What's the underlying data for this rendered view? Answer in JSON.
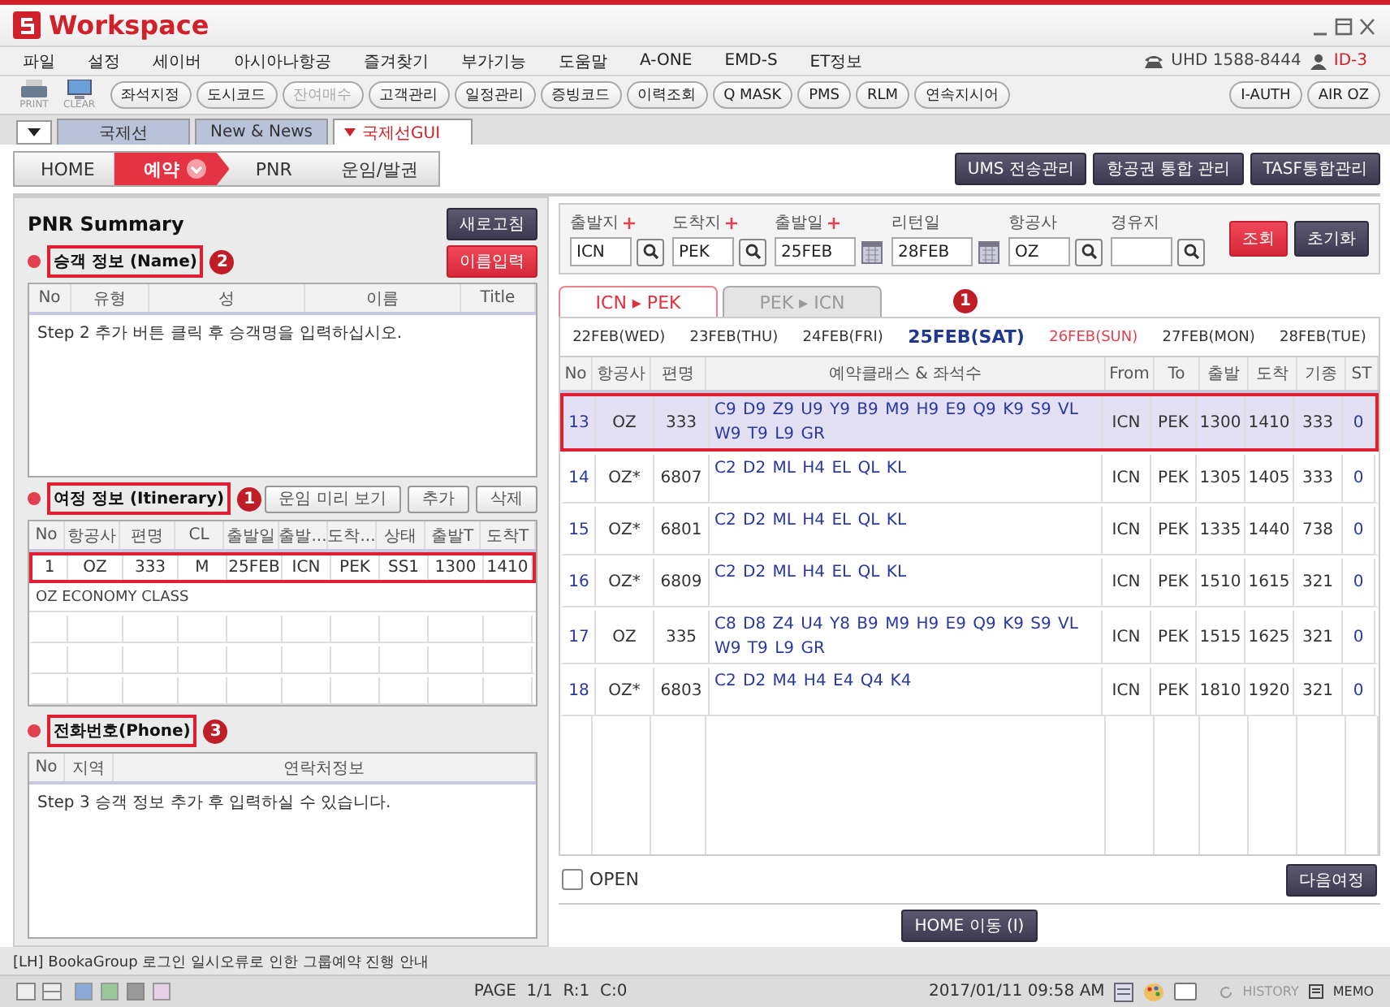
{
  "window": {
    "title": "Workspace"
  },
  "menu": [
    "파일",
    "설정",
    "세이버",
    "아시아나항공",
    "즐겨찾기",
    "부가기능",
    "도움말",
    "A-ONE",
    "EMD-S",
    "ET정보"
  ],
  "support": {
    "phone": "UHD 1588-8444",
    "user": "ID-3"
  },
  "toolbar": {
    "icon_buttons": [
      {
        "label": "PRINT",
        "kind": "printer"
      },
      {
        "label": "CLEAR",
        "kind": "monitor"
      }
    ],
    "buttons": [
      {
        "label": "좌석지정",
        "disabled": false
      },
      {
        "label": "도시코드",
        "disabled": false
      },
      {
        "label": "잔여매수",
        "disabled": true
      },
      {
        "label": "고객관리",
        "disabled": false
      },
      {
        "label": "일정관리",
        "disabled": false
      },
      {
        "label": "증빙코드",
        "disabled": false
      },
      {
        "label": "이력조회",
        "disabled": false
      },
      {
        "label": "Q MASK",
        "disabled": false
      },
      {
        "label": "PMS",
        "disabled": false
      },
      {
        "label": "RLM",
        "disabled": false
      },
      {
        "label": "연속지시어",
        "disabled": false
      }
    ],
    "right_buttons": [
      {
        "label": "I-AUTH",
        "disabled": false
      },
      {
        "label": "AIR OZ",
        "disabled": false
      }
    ]
  },
  "tabs": [
    {
      "label": "국제선",
      "selected": false
    },
    {
      "label": "New & News",
      "selected": false
    },
    {
      "label": "국제선GUI",
      "selected": true
    }
  ],
  "breadcrumb": [
    {
      "label": "HOME",
      "selected": false
    },
    {
      "label": "예약",
      "selected": true
    },
    {
      "label": "PNR",
      "selected": false
    },
    {
      "label": "운임/발권",
      "selected": false
    }
  ],
  "top_actions": [
    "UMS 전송관리",
    "항공권 통합 관리",
    "TASF통합관리"
  ],
  "pnr": {
    "title": "PNR Summary",
    "refresh": "새로고침",
    "name": {
      "title": "승객 정보 (Name)",
      "callout": "2",
      "highlighted": true,
      "action": "이름입력",
      "columns": [
        "No",
        "유형",
        "성",
        "이름",
        "Title"
      ],
      "hint": "Step 2 추가 버튼 클릭 후 승객명을 입력하십시오."
    },
    "itinerary": {
      "title": "여정 정보 (Itinerary)",
      "callout": "1",
      "highlighted": true,
      "actions": [
        "운임 미리 보기",
        "추가",
        "삭제"
      ],
      "columns": [
        "No",
        "항공사",
        "편명",
        "CL",
        "출발일",
        "출발...",
        "도착...",
        "상태",
        "출발T",
        "도착T"
      ],
      "rows": [
        {
          "cells": [
            "1",
            "OZ",
            "333",
            "M",
            "25FEB",
            "ICN",
            "PEK",
            "SS1",
            "1300",
            "1410"
          ],
          "highlighted": true
        }
      ],
      "note": "OZ ECONOMY CLASS"
    },
    "phone": {
      "title": "전화번호(Phone)",
      "callout": "3",
      "highlighted": true,
      "columns": [
        "No",
        "지역",
        "연락처정보"
      ],
      "hint": "Step 3 승객 정보 추가 후 입력하실 수 있습니다."
    }
  },
  "search": {
    "fields": [
      {
        "label": "출발지",
        "required": true,
        "value": "ICN",
        "kind": "lookup"
      },
      {
        "label": "도착지",
        "required": true,
        "value": "PEK",
        "kind": "lookup"
      },
      {
        "label": "출발일",
        "required": true,
        "value": "25FEB",
        "kind": "date"
      },
      {
        "label": "리턴일",
        "required": false,
        "value": "28FEB",
        "kind": "date"
      },
      {
        "label": "항공사",
        "required": false,
        "value": "OZ",
        "kind": "lookup"
      },
      {
        "label": "경유지",
        "required": false,
        "kind": "lookup"
      }
    ],
    "submit": "조회",
    "reset": "초기화"
  },
  "route_tabs": [
    {
      "label": "ICN ▸ PEK",
      "selected": true
    },
    {
      "label": "PEK ▸ ICN",
      "selected": false
    }
  ],
  "route_callout": "1",
  "dates": [
    {
      "label": "22FEB(WED)",
      "selected": false,
      "holiday": false
    },
    {
      "label": "23FEB(THU)",
      "selected": false,
      "holiday": false
    },
    {
      "label": "24FEB(FRI)",
      "selected": false,
      "holiday": false
    },
    {
      "label": "25FEB(SAT)",
      "selected": true,
      "holiday": false
    },
    {
      "label": "26FEB(SUN)",
      "selected": false,
      "holiday": true
    },
    {
      "label": "27FEB(MON)",
      "selected": false,
      "holiday": false
    },
    {
      "label": "28FEB(TUE)",
      "selected": false,
      "holiday": false
    }
  ],
  "flights": {
    "columns": [
      "No",
      "항공사",
      "편명",
      "예약클래스 & 좌석수",
      "From",
      "To",
      "출발",
      "도착",
      "기종",
      "ST"
    ],
    "rows": [
      {
        "no": "13",
        "airline": "OZ",
        "flight": "333",
        "classes": "C9 D9 Z9 U9 Y9 B9 M9 H9 E9 Q9 K9 S9 VL W9 T9 L9 GR",
        "from": "ICN",
        "to": "PEK",
        "dep": "1300",
        "arr": "1410",
        "type": "333",
        "st": "0",
        "selected": true
      },
      {
        "no": "14",
        "airline": "OZ*",
        "flight": "6807",
        "classes": "C2 D2 ML H4 EL QL KL",
        "from": "ICN",
        "to": "PEK",
        "dep": "1305",
        "arr": "1405",
        "type": "333",
        "st": "0",
        "selected": false
      },
      {
        "no": "15",
        "airline": "OZ*",
        "flight": "6801",
        "classes": "C2 D2 ML H4 EL QL KL",
        "from": "ICN",
        "to": "PEK",
        "dep": "1335",
        "arr": "1440",
        "type": "738",
        "st": "0",
        "selected": false
      },
      {
        "no": "16",
        "airline": "OZ*",
        "flight": "6809",
        "classes": "C2 D2 ML H4 EL QL KL",
        "from": "ICN",
        "to": "PEK",
        "dep": "1510",
        "arr": "1615",
        "type": "321",
        "st": "0",
        "selected": false
      },
      {
        "no": "17",
        "airline": "OZ",
        "flight": "335",
        "classes": "C8 D8 Z4 U4 Y8 B9 M9 H9 E9 Q9 K9 S9 VL W9 T9 L9 GR",
        "from": "ICN",
        "to": "PEK",
        "dep": "1515",
        "arr": "1625",
        "type": "321",
        "st": "0",
        "selected": false
      },
      {
        "no": "18",
        "airline": "OZ*",
        "flight": "6803",
        "classes": "C2 D2 M4 H4 E4 Q4 K4",
        "from": "ICN",
        "to": "PEK",
        "dep": "1810",
        "arr": "1920",
        "type": "321",
        "st": "0",
        "selected": false
      }
    ]
  },
  "open": {
    "label": "OPEN",
    "checked": false
  },
  "next": "다음여정",
  "home_button": "HOME 이동 (I)",
  "notice": "[LH] BookaGroup 로그인 일시오류로 인한 그룹예약 진행 안내",
  "status": {
    "page": "PAGE  1/1  R:1  C:0",
    "datetime": "2017/01/11 09:58 AM",
    "history": "HISTORY",
    "memo": "MEMO"
  }
}
